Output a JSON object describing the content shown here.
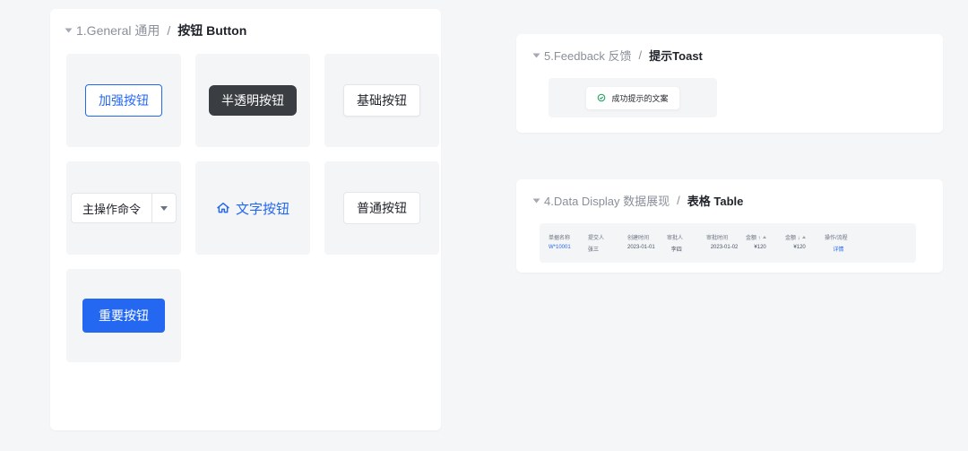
{
  "panels": {
    "general": {
      "breadcrumb_muted": "1.General 通用",
      "breadcrumb_sep": "/",
      "breadcrumb_current": "按钮 Button"
    },
    "feedback": {
      "breadcrumb_muted": "5.Feedback 反馈",
      "breadcrumb_sep": "/",
      "breadcrumb_current": "提示Toast"
    },
    "datadisplay": {
      "breadcrumb_muted": "4.Data Display 数据展现",
      "breadcrumb_sep": "/",
      "breadcrumb_current": "表格 Table"
    }
  },
  "buttons": {
    "enhanced": "加强按钮",
    "semi": "半透明按钮",
    "basic": "基础按钮",
    "split_main": "主操作命令",
    "text_icon": "文字按钮",
    "default": "普通按钮",
    "primary": "重要按钮"
  },
  "toast": {
    "success_text": "成功提示的文案"
  },
  "table_preview": {
    "headers": [
      "单据名称",
      "提交人",
      "创建时间",
      "审批人",
      "审批时间",
      "金额 ↑",
      "金额 ↓",
      "操作/流程"
    ],
    "row": [
      "W*10001",
      "张三",
      "2023-01-01",
      "李四",
      "2023-01-02",
      "¥120",
      "¥120",
      "详情"
    ]
  },
  "colors": {
    "primary": "#2468f2",
    "success": "#18a058",
    "bg": "#f5f6f8"
  }
}
